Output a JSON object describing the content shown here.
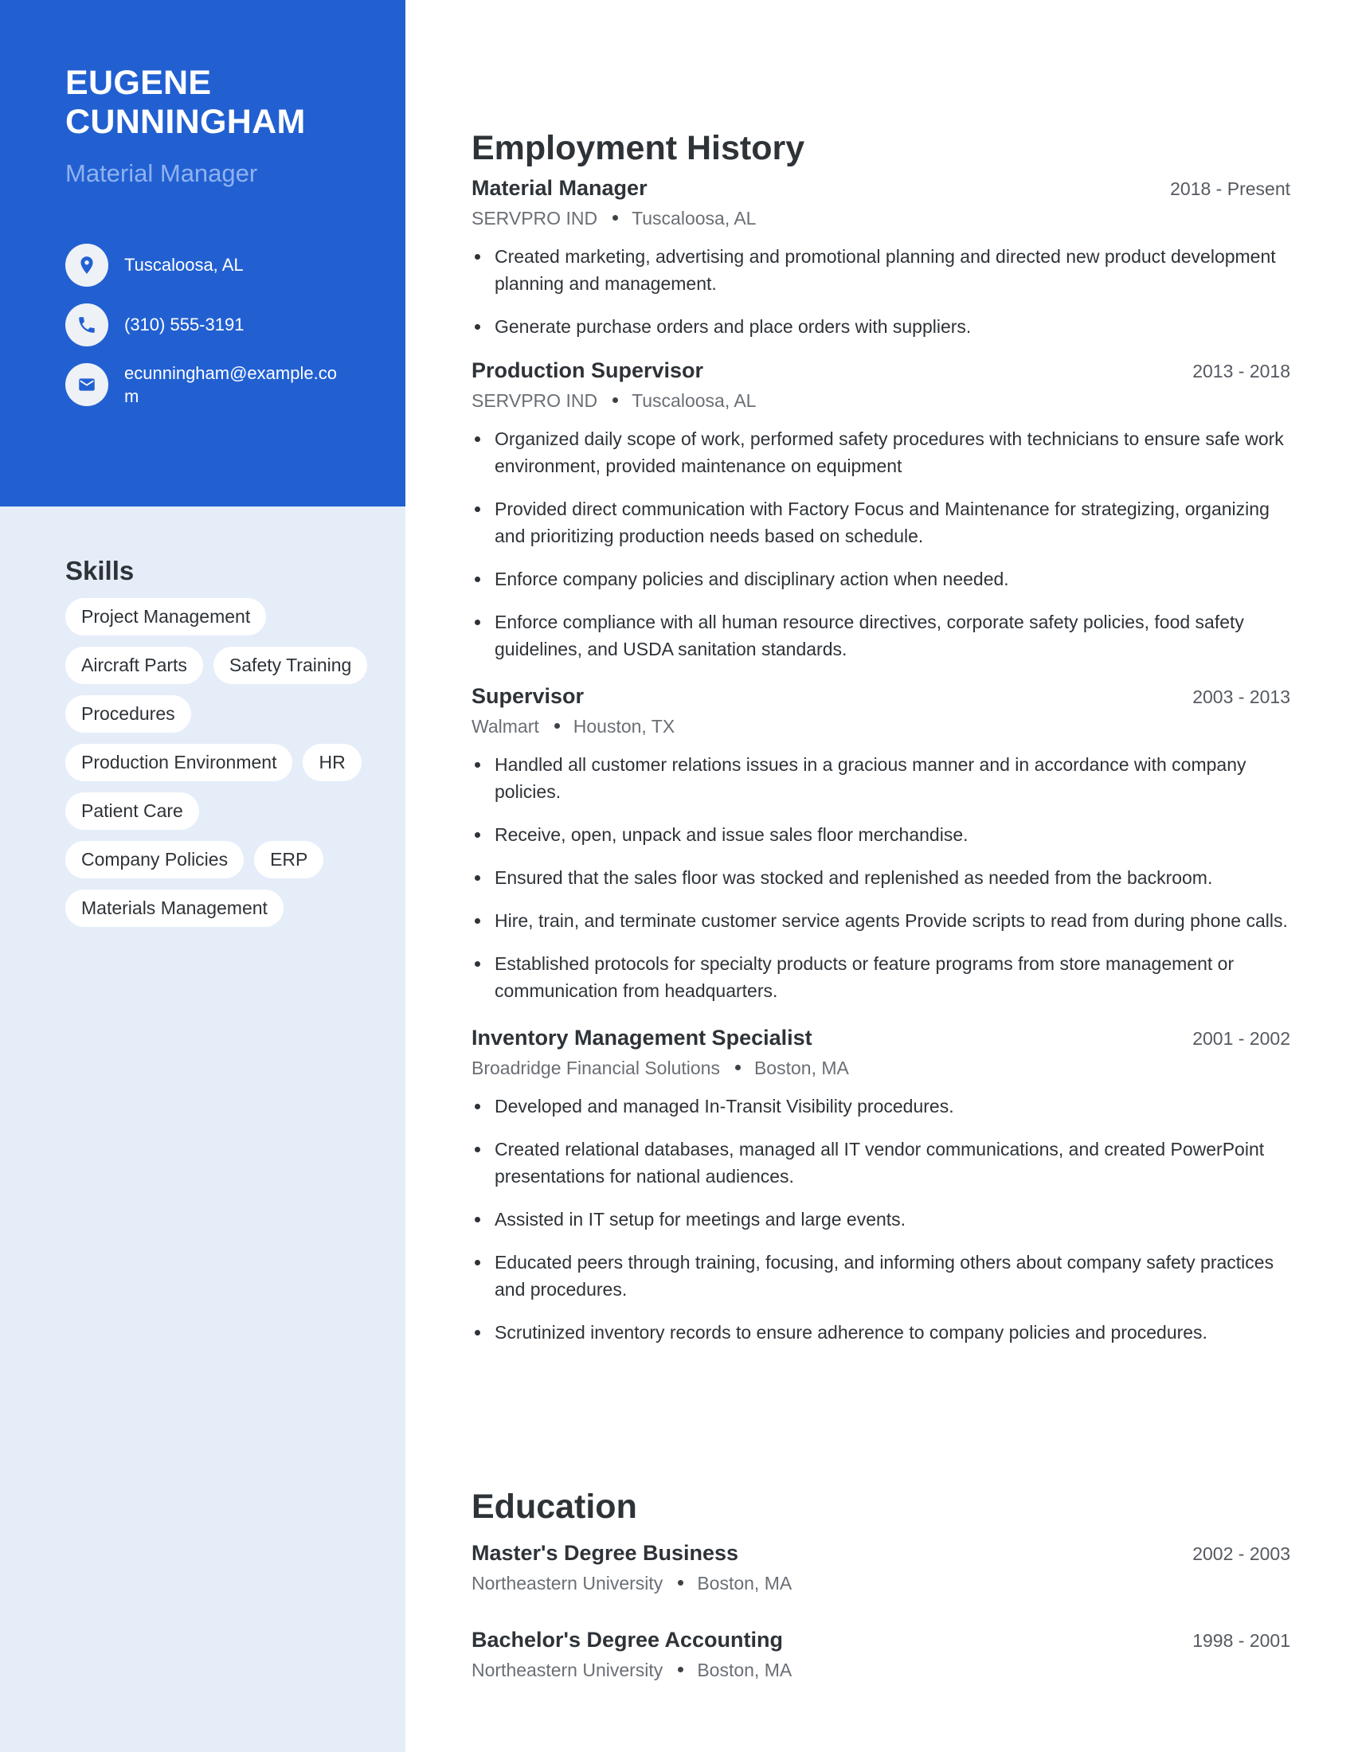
{
  "profile": {
    "name_first": "EUGENE",
    "name_last": "CUNNINGHAM",
    "title": "Material Manager",
    "contact": {
      "location": "Tuscaloosa, AL",
      "phone": "(310) 555-3191",
      "email": "ecunningham@example.com"
    },
    "icons": {
      "location": "map-pin-icon",
      "phone": "phone-icon",
      "email": "envelope-icon"
    }
  },
  "colors": {
    "sidebar_header": "#2260d2",
    "sidebar_body": "#e5edf9",
    "subtitle": "#8fb2f0",
    "text": "#2e3338"
  },
  "skills": {
    "title": "Skills",
    "items": [
      "Project Management",
      "Aircraft Parts",
      "Safety Training",
      "Procedures",
      "Production Environment",
      "HR",
      "Patient Care",
      "Company Policies",
      "ERP",
      "Materials Management"
    ]
  },
  "employment": {
    "title": "Employment History",
    "jobs": [
      {
        "role": "Material Manager",
        "dates": "2018 - Present",
        "company": "SERVPRO IND",
        "location": "Tuscaloosa, AL",
        "bullets": [
          "Created marketing, advertising and promotional planning and directed new product development planning and management.",
          "Generate purchase orders and place orders with suppliers."
        ]
      },
      {
        "role": "Production Supervisor",
        "dates": "2013 - 2018",
        "company": "SERVPRO IND",
        "location": "Tuscaloosa, AL",
        "bullets": [
          "Organized daily scope of work, performed safety procedures with technicians to ensure safe work environment, provided maintenance on equipment",
          "Provided direct communication with Factory Focus and Maintenance for strategizing, organizing and prioritizing production needs based on schedule.",
          "Enforce company policies and disciplinary action when needed.",
          "Enforce compliance with all human resource directives, corporate safety policies, food safety guidelines, and USDA sanitation standards."
        ]
      },
      {
        "role": "Supervisor",
        "dates": "2003 - 2013",
        "company": "Walmart",
        "location": "Houston, TX",
        "bullets": [
          "Handled all customer relations issues in a gracious manner and in accordance with company policies.",
          "Receive, open, unpack and issue sales floor merchandise.",
          "Ensured that the sales floor was stocked and replenished as needed from the backroom.",
          "Hire, train, and terminate customer service agents Provide scripts to read from during phone calls.",
          "Established protocols for specialty products or feature programs from store management or communication from headquarters."
        ]
      },
      {
        "role": "Inventory Management Specialist",
        "dates": "2001 - 2002",
        "company": "Broadridge Financial Solutions",
        "location": "Boston, MA",
        "bullets": [
          "Developed and managed In-Transit Visibility procedures.",
          "Created relational databases, managed all IT vendor communications, and created PowerPoint presentations for national audiences.",
          "Assisted in IT setup for meetings and large events.",
          "Educated peers through training, focusing, and informing others about company safety practices and procedures.",
          "Scrutinized inventory records to ensure adherence to company policies and procedures."
        ]
      }
    ]
  },
  "education": {
    "title": "Education",
    "items": [
      {
        "degree": "Master's Degree Business",
        "dates": "2002 - 2003",
        "school": "Northeastern University",
        "location": "Boston, MA"
      },
      {
        "degree": "Bachelor's Degree Accounting",
        "dates": "1998 - 2001",
        "school": "Northeastern University",
        "location": "Boston, MA"
      }
    ]
  }
}
